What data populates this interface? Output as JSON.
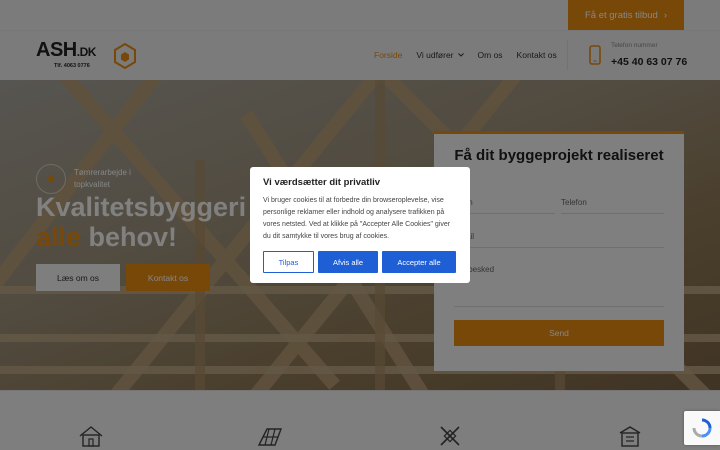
{
  "topbar": {
    "quote_label": "Få et gratis tilbud",
    "quote_arrow": "›"
  },
  "logo": {
    "name": "ASH",
    "tld": ".DK",
    "phone": "Tlf. 4063 0776"
  },
  "nav": {
    "items": [
      {
        "label": "Forside",
        "active": true
      },
      {
        "label": "Vi udfører",
        "dropdown": true
      },
      {
        "label": "Om os"
      },
      {
        "label": "Kontakt os"
      }
    ]
  },
  "contact": {
    "label": "Telefon nummer",
    "phone": "+45 40 63 07 76"
  },
  "hero": {
    "badge": "Tømrerarbejde i topkvalitet",
    "title_line1": "Kvalitetsbyggeri til",
    "title_accent": "alle",
    "title_rest": " behov!",
    "read_label": "Læs om os",
    "contact_label": "Kontakt os"
  },
  "form": {
    "title": "Få dit byggeprojekt realiseret",
    "name_placeholder": "Navn",
    "phone_placeholder": "Telefon",
    "email_placeholder": "Email",
    "message_placeholder": "Din besked",
    "send_label": "Send"
  },
  "cookie": {
    "title": "Vi værdsætter dit privatliv",
    "body": "Vi bruger cookies til at forbedre din browseroplevelse, vise personlige reklamer eller indhold og analysere trafikken på vores netsted. Ved at klikke på \"Accepter Alle Cookies\" giver du dit samtykke til vores brug af cookies.",
    "customize_label": "Tilpas",
    "reject_label": "Afvis alle",
    "accept_label": "Accepter alle"
  },
  "colors": {
    "accent": "#e78a12",
    "cookie_blue": "#1f5fd6"
  }
}
